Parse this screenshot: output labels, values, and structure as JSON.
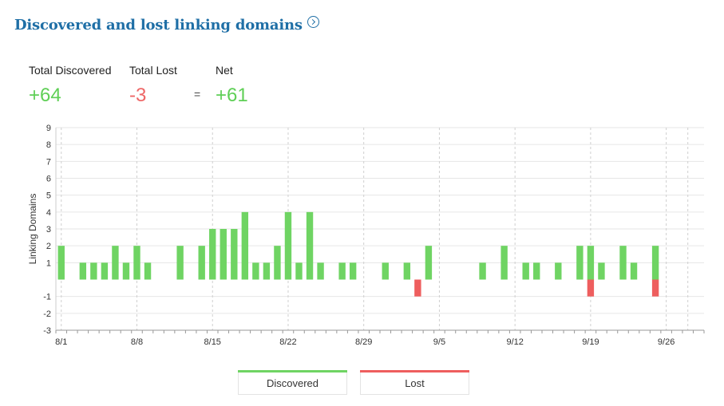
{
  "header": {
    "title": "Discovered and lost linking domains",
    "info_icon": "chevron-right-circle-icon"
  },
  "summary": {
    "discovered_label": "Total Discovered",
    "discovered_value": "+64",
    "lost_label": "Total Lost",
    "lost_value": "-3",
    "equals": "=",
    "net_label": "Net",
    "net_value": "+61"
  },
  "colors": {
    "discovered": "#6fd463",
    "lost": "#ee5e5e",
    "grid": "#e6e6e6",
    "title": "#1f6fa6"
  },
  "chart_data": {
    "type": "bar",
    "ylabel": "Linking Domains",
    "ylim": [
      -3,
      9
    ],
    "yticks": [
      9,
      8,
      7,
      6,
      5,
      4,
      3,
      2,
      1,
      -1,
      -2,
      -3
    ],
    "xtick_labels": [
      "8/1",
      "8/8",
      "8/15",
      "8/22",
      "8/29",
      "9/5",
      "9/12",
      "9/19",
      "9/26"
    ],
    "x_start": "8/1",
    "x_end": "9/29",
    "grid": true,
    "legend_position": "bottom",
    "categories": [
      "8/1",
      "8/2",
      "8/3",
      "8/4",
      "8/5",
      "8/6",
      "8/7",
      "8/8",
      "8/9",
      "8/10",
      "8/11",
      "8/12",
      "8/13",
      "8/14",
      "8/15",
      "8/16",
      "8/17",
      "8/18",
      "8/19",
      "8/20",
      "8/21",
      "8/22",
      "8/23",
      "8/24",
      "8/25",
      "8/26",
      "8/27",
      "8/28",
      "8/29",
      "8/30",
      "8/31",
      "9/1",
      "9/2",
      "9/3",
      "9/4",
      "9/5",
      "9/6",
      "9/7",
      "9/8",
      "9/9",
      "9/10",
      "9/11",
      "9/12",
      "9/13",
      "9/14",
      "9/15",
      "9/16",
      "9/17",
      "9/18",
      "9/19",
      "9/20",
      "9/21",
      "9/22",
      "9/23",
      "9/24",
      "9/25"
    ],
    "series": [
      {
        "name": "Discovered",
        "values": [
          2,
          0,
          1,
          1,
          1,
          2,
          1,
          2,
          1,
          0,
          0,
          2,
          0,
          2,
          3,
          3,
          3,
          4,
          1,
          1,
          2,
          4,
          1,
          4,
          1,
          0,
          1,
          1,
          0,
          0,
          1,
          0,
          1,
          0,
          2,
          0,
          0,
          0,
          0,
          1,
          0,
          2,
          0,
          1,
          1,
          0,
          1,
          0,
          2,
          2,
          1,
          0,
          2,
          1,
          0,
          2
        ]
      },
      {
        "name": "Lost",
        "values": [
          0,
          0,
          0,
          0,
          0,
          0,
          0,
          0,
          0,
          0,
          0,
          0,
          0,
          0,
          0,
          0,
          0,
          0,
          0,
          0,
          0,
          0,
          0,
          0,
          0,
          0,
          0,
          0,
          0,
          0,
          0,
          0,
          0,
          -1,
          0,
          0,
          0,
          0,
          0,
          0,
          0,
          0,
          0,
          0,
          0,
          0,
          0,
          0,
          0,
          -1,
          0,
          0,
          0,
          0,
          0,
          -1
        ]
      }
    ]
  },
  "legend": {
    "discovered_label": "Discovered",
    "lost_label": "Lost"
  }
}
